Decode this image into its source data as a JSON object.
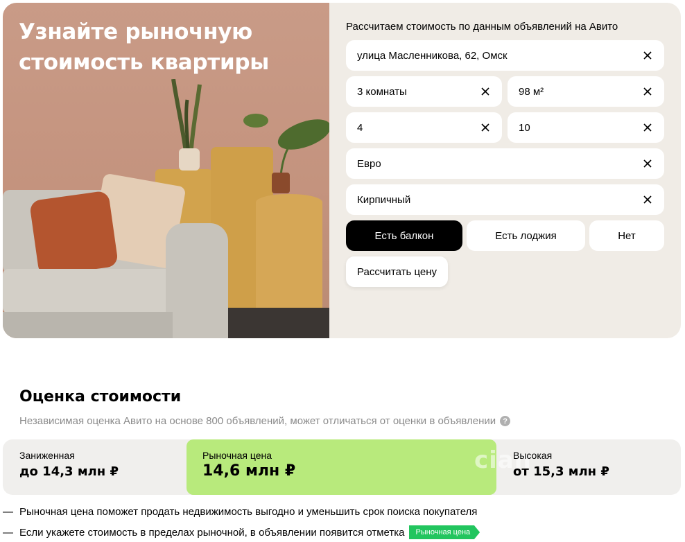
{
  "hero": {
    "title": "Узнайте рыночную стоимость квартиры"
  },
  "form": {
    "caption": "Рассчитаем стоимость по данным объявлений на Авито",
    "address": "улица Масленникова, 62, Омск",
    "rooms": "3 комнаты",
    "area": "98 м²",
    "floor": "4",
    "floors_total": "10",
    "renovation": "Евро",
    "house_type": "Кирпичный",
    "balcony_options": [
      "Есть балкон",
      "Есть лоджия",
      "Нет"
    ],
    "balcony_selected": "Есть балкон",
    "calculate_label": "Рассчитать цену"
  },
  "estimate": {
    "title": "Оценка стоимости",
    "subtitle": "Независимая оценка Авито на основе 800 объявлений, может отличаться от оценки в объявлении",
    "help_icon": "?",
    "low_label": "Заниженная",
    "low_value": "до 14,3 млн ₽",
    "market_label": "Рыночная цена",
    "market_value": "14,6 млн ₽",
    "high_label": "Высокая",
    "high_value": "от 15,3 млн ₽",
    "watermark": "cian"
  },
  "notes": {
    "line1": "Рыночная цена поможет продать недвижимость выгодно и уменьшить срок поиска покупателя",
    "line2": "Если укажете стоимость в пределах рыночной, в объявлении появится отметка",
    "badge": "Рыночная цена",
    "dash": "—"
  },
  "colors": {
    "market_green": "#b8ea7c",
    "badge_green": "#22c55e",
    "form_bg": "#f0ece6",
    "selected_black": "#000000"
  },
  "icons": {
    "clear": "close-icon",
    "help": "question-circle-icon"
  }
}
